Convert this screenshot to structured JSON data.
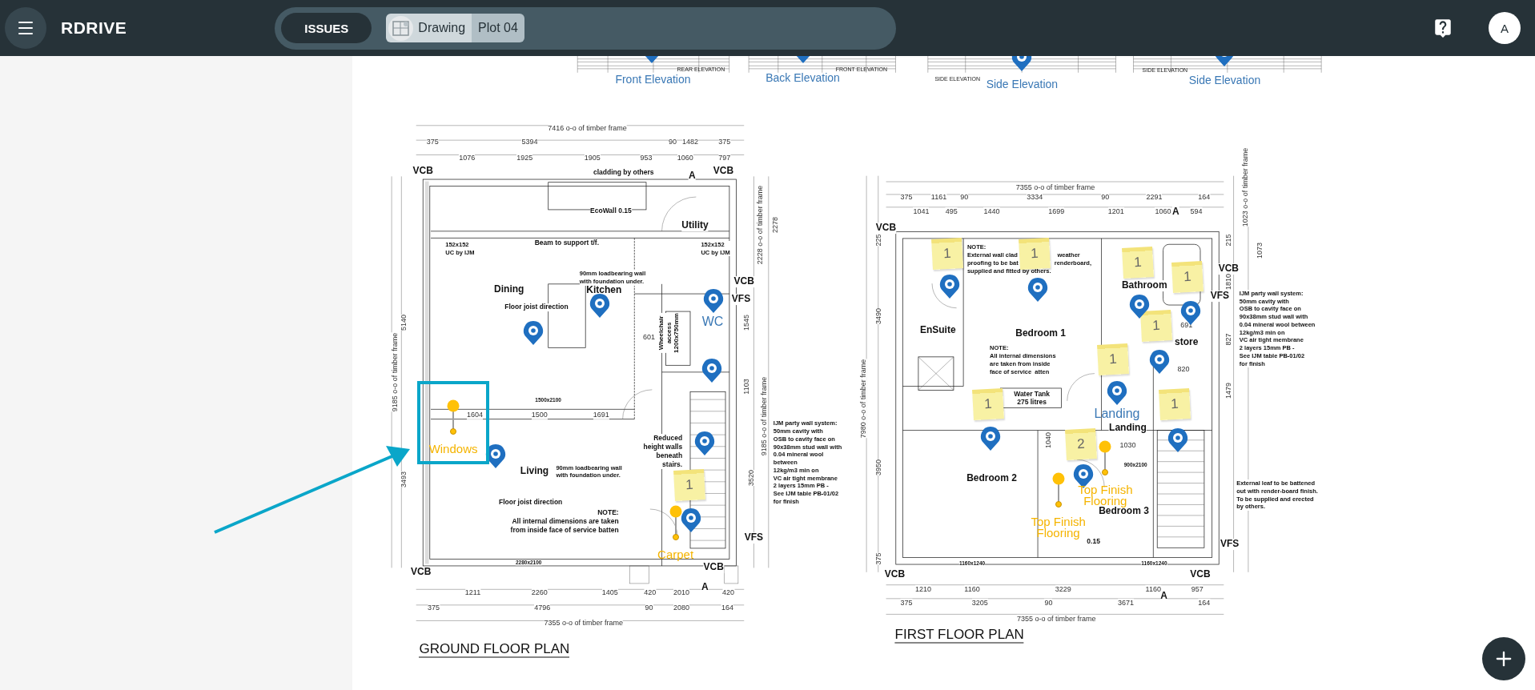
{
  "top_bar": {
    "brand": "RDRIVE",
    "tab": {
      "label": "ISSUES",
      "selected": true
    },
    "breadcrumb": [
      {
        "label": "Drawing"
      },
      {
        "label": "Plot 04"
      }
    ],
    "avatar": "A"
  },
  "elevations": [
    {
      "label": "Front Elevation",
      "caption": "REAR ELEVATION"
    },
    {
      "label": "Back Elevation",
      "caption": "FRONT ELEVATION"
    },
    {
      "label": "Side Elevation",
      "caption": "SIDE ELEVATION"
    },
    {
      "label": "Side Elevation",
      "caption": "SIDE ELEVATION"
    }
  ],
  "plans": [
    {
      "title": "GROUND FLOOR PLAN",
      "labels": [
        {
          "text": "7416 o-o of timber frame",
          "kind": "dim"
        },
        {
          "text": "375",
          "kind": "dim"
        },
        {
          "text": "5394",
          "kind": "dim"
        },
        {
          "text": "90",
          "kind": "dim"
        },
        {
          "text": "1482",
          "kind": "dim"
        },
        {
          "text": "375",
          "kind": "dim"
        },
        {
          "text": "1076",
          "kind": "dim"
        },
        {
          "text": "1925",
          "kind": "dim"
        },
        {
          "text": "1905",
          "kind": "dim"
        },
        {
          "text": "953",
          "kind": "dim"
        },
        {
          "text": "1060",
          "kind": "dim"
        },
        {
          "text": "797",
          "kind": "dim"
        },
        {
          "text": "VCB",
          "kind": "tag"
        },
        {
          "text": "cladding by others",
          "kind": "small"
        },
        {
          "text": "A",
          "kind": "tag"
        },
        {
          "text": "VCB",
          "kind": "tag"
        },
        {
          "text": "EcoWall 0.15",
          "kind": "small"
        },
        {
          "text": "Utility",
          "kind": "room"
        },
        {
          "text": "Beam to support t/f.",
          "kind": "small"
        },
        {
          "text": "152x152\nUC by IJM",
          "kind": "note"
        },
        {
          "text": "152x152\nUC by IJM",
          "kind": "note"
        },
        {
          "text": "90mm loadbearing wall\nwith foundation under.",
          "kind": "note"
        },
        {
          "text": "Dining",
          "kind": "room"
        },
        {
          "text": "Kitchen",
          "kind": "room"
        },
        {
          "text": "Floor joist direction",
          "kind": "small"
        },
        {
          "text": "VCB",
          "kind": "tag"
        },
        {
          "text": "VFS",
          "kind": "tag"
        },
        {
          "text": "601",
          "kind": "dim"
        },
        {
          "text": "Wheelchair\naccess\n1200x750mm",
          "kind": "vnote"
        },
        {
          "text": "1500x2100",
          "kind": "tiny"
        },
        {
          "text": "1604",
          "kind": "dim"
        },
        {
          "text": "1500",
          "kind": "dim"
        },
        {
          "text": "1691",
          "kind": "dim"
        },
        {
          "text": "Living",
          "kind": "room"
        },
        {
          "text": "90mm loadbearing wall\nwith foundation under.",
          "kind": "note"
        },
        {
          "text": "Floor joist direction",
          "kind": "small"
        },
        {
          "text": "NOTE:\nAll internal dimensions are taken\nfrom inside face of service batten",
          "kind": "rnote"
        },
        {
          "text": "Reduced\nheight walls\nbeneath\nstairs.",
          "kind": "rnote"
        },
        {
          "text": "IJM party wall system:\n50mm cavity with\nOSB to cavity face on\n90x38mm stud wall with\n0.04 mineral wool\nbetween\n12kg/m3 min on\nVC air tight membrane\n2 layers 15mm PB -\nSee IJM table PB-01/02\nfor finish",
          "kind": "note"
        },
        {
          "text": "VFS",
          "kind": "tag"
        },
        {
          "text": "2280x2100",
          "kind": "tiny"
        },
        {
          "text": "VCB",
          "kind": "tag"
        },
        {
          "text": "VCB",
          "kind": "tag"
        },
        {
          "text": "1211",
          "kind": "dim"
        },
        {
          "text": "2260",
          "kind": "dim"
        },
        {
          "text": "1405",
          "kind": "dim"
        },
        {
          "text": "420",
          "kind": "dim"
        },
        {
          "text": "2010",
          "kind": "dim"
        },
        {
          "text": "420",
          "kind": "dim"
        },
        {
          "text": "A",
          "kind": "tag"
        },
        {
          "text": "375",
          "kind": "dim"
        },
        {
          "text": "4796",
          "kind": "dim"
        },
        {
          "text": "90",
          "kind": "dim"
        },
        {
          "text": "2080",
          "kind": "dim"
        },
        {
          "text": "164",
          "kind": "dim"
        },
        {
          "text": "7355 o-o of timber frame",
          "kind": "dim"
        },
        {
          "text": "9185 o-o of timber frame",
          "kind": "vdim"
        },
        {
          "text": "5140",
          "kind": "vdim"
        },
        {
          "text": "3493",
          "kind": "vdim"
        },
        {
          "text": "2278",
          "kind": "vdim"
        },
        {
          "text": "2228 o-o of timber frame",
          "kind": "vdim"
        },
        {
          "text": "9185 o-o of timber frame",
          "kind": "vdim"
        },
        {
          "text": "3520",
          "kind": "vdim"
        },
        {
          "text": "1545",
          "kind": "vdim"
        },
        {
          "text": "1103",
          "kind": "vdim"
        }
      ]
    },
    {
      "title": "FIRST FLOOR PLAN",
      "labels": [
        {
          "text": "7355 o-o of timber frame",
          "kind": "dim"
        },
        {
          "text": "375",
          "kind": "dim"
        },
        {
          "text": "1161",
          "kind": "dim"
        },
        {
          "text": "90",
          "kind": "dim"
        },
        {
          "text": "3334",
          "kind": "dim"
        },
        {
          "text": "90",
          "kind": "dim"
        },
        {
          "text": "2291",
          "kind": "dim"
        },
        {
          "text": "164",
          "kind": "dim"
        },
        {
          "text": "1041",
          "kind": "dim"
        },
        {
          "text": "495",
          "kind": "dim"
        },
        {
          "text": "1440",
          "kind": "dim"
        },
        {
          "text": "1699",
          "kind": "dim"
        },
        {
          "text": "1201",
          "kind": "dim"
        },
        {
          "text": "1060",
          "kind": "dim"
        },
        {
          "text": "A",
          "kind": "tag"
        },
        {
          "text": "594",
          "kind": "dim"
        },
        {
          "text": "VCB",
          "kind": "tag"
        },
        {
          "text": "NOTE:",
          "kind": "note"
        },
        {
          "text": "External wall clad",
          "kind": "note"
        },
        {
          "text": "weather",
          "kind": "note"
        },
        {
          "text": "proofing to be bat",
          "kind": "note"
        },
        {
          "text": "renderboard,",
          "kind": "note"
        },
        {
          "text": "supplied and fitted by others.",
          "kind": "note"
        },
        {
          "text": "EnSuite",
          "kind": "room"
        },
        {
          "text": "Bedroom 1",
          "kind": "room"
        },
        {
          "text": "NOTE:\nAll internal dimensions\nare taken from inside\nface of service  atten",
          "kind": "note"
        },
        {
          "text": "Water Tank\n275 litres",
          "kind": "cnote"
        },
        {
          "text": "Bathroom",
          "kind": "room"
        },
        {
          "text": "VCB",
          "kind": "tag"
        },
        {
          "text": "VFS",
          "kind": "tag"
        },
        {
          "text": "691",
          "kind": "dim"
        },
        {
          "text": "store",
          "kind": "room"
        },
        {
          "text": "820",
          "kind": "dim"
        },
        {
          "text": "IJM party wall system:\n50mm cavity with\nOSB to cavity face on\n90x38mm stud wall with\n0.04 mineral wool between\n12kg/m3 min on\nVC air tight membrane\n2 layers 15mm PB -\nSee IJM table PB-01/02\nfor finish",
          "kind": "note"
        },
        {
          "text": "Landing",
          "kind": "room"
        },
        {
          "text": "3490",
          "kind": "vdim"
        },
        {
          "text": "7980 o-o of timber frame",
          "kind": "vdim"
        },
        {
          "text": "225",
          "kind": "vdim"
        },
        {
          "text": "1023 o-o of timber frame",
          "kind": "vdim"
        },
        {
          "text": "1073",
          "kind": "vdim"
        },
        {
          "text": "215",
          "kind": "vdim"
        },
        {
          "text": "1810",
          "kind": "vdim"
        },
        {
          "text": "827",
          "kind": "vdim"
        },
        {
          "text": "1479",
          "kind": "vdim"
        },
        {
          "text": "1040",
          "kind": "vdim"
        },
        {
          "text": "1030",
          "kind": "dim"
        },
        {
          "text": "900x2100",
          "kind": "tiny"
        },
        {
          "text": "Bedroom 2",
          "kind": "room"
        },
        {
          "text": "Bedroom 3",
          "kind": "room"
        },
        {
          "text": "0.15",
          "kind": "small"
        },
        {
          "text": "External leaf to be battened\nout with render-board finish.\nTo be supplied and erected\nby others.",
          "kind": "note"
        },
        {
          "text": "VFS",
          "kind": "tag"
        },
        {
          "text": "1160x1240",
          "kind": "tiny"
        },
        {
          "text": "1160x1240",
          "kind": "tiny"
        },
        {
          "text": "VCB",
          "kind": "tag"
        },
        {
          "text": "VCB",
          "kind": "tag"
        },
        {
          "text": "1210",
          "kind": "dim"
        },
        {
          "text": "1160",
          "kind": "dim"
        },
        {
          "text": "3229",
          "kind": "dim"
        },
        {
          "text": "1160",
          "kind": "dim"
        },
        {
          "text": "957",
          "kind": "dim"
        },
        {
          "text": "375",
          "kind": "dim"
        },
        {
          "text": "3205",
          "kind": "dim"
        },
        {
          "text": "90",
          "kind": "dim"
        },
        {
          "text": "3671",
          "kind": "dim"
        },
        {
          "text": "A",
          "kind": "tag"
        },
        {
          "text": "164",
          "kind": "dim"
        },
        {
          "text": "7355 o-o of timber frame",
          "kind": "dim"
        },
        {
          "text": "3950",
          "kind": "vdim"
        },
        {
          "text": "375",
          "kind": "vdim"
        }
      ]
    }
  ],
  "markers": [
    {
      "kind": "pin"
    },
    {
      "kind": "pin"
    },
    {
      "kind": "pin"
    },
    {
      "kind": "pin"
    },
    {
      "kind": "pin"
    },
    {
      "kind": "pin"
    },
    {
      "kind": "pin"
    },
    {
      "kind": "label",
      "label": "WC"
    },
    {
      "kind": "pin"
    },
    {
      "kind": "pin"
    },
    {
      "kind": "pin"
    },
    {
      "kind": "note",
      "count": "1"
    },
    {
      "kind": "pin"
    },
    {
      "kind": "tag",
      "label": "Windows",
      "selected": true
    },
    {
      "kind": "tag",
      "label": "Carpet",
      "selected": false
    },
    {
      "kind": "note",
      "count": "1"
    },
    {
      "kind": "note",
      "count": "1"
    },
    {
      "kind": "note",
      "count": "1"
    },
    {
      "kind": "note",
      "count": "1"
    },
    {
      "kind": "note",
      "count": "1"
    },
    {
      "kind": "note",
      "count": "1"
    },
    {
      "kind": "note",
      "count": "1"
    },
    {
      "kind": "note",
      "count": "1"
    },
    {
      "kind": "note",
      "count": "2"
    },
    {
      "kind": "label",
      "label": "Landing"
    },
    {
      "kind": "pin"
    },
    {
      "kind": "pin"
    },
    {
      "kind": "pin"
    },
    {
      "kind": "pin"
    },
    {
      "kind": "pin"
    },
    {
      "kind": "pin"
    },
    {
      "kind": "pin"
    },
    {
      "kind": "pin"
    },
    {
      "kind": "pin"
    },
    {
      "kind": "tag",
      "label": "Top Finish Flooring",
      "selected": false
    },
    {
      "kind": "tag",
      "label": "Top Finish Flooring",
      "selected": false
    }
  ]
}
